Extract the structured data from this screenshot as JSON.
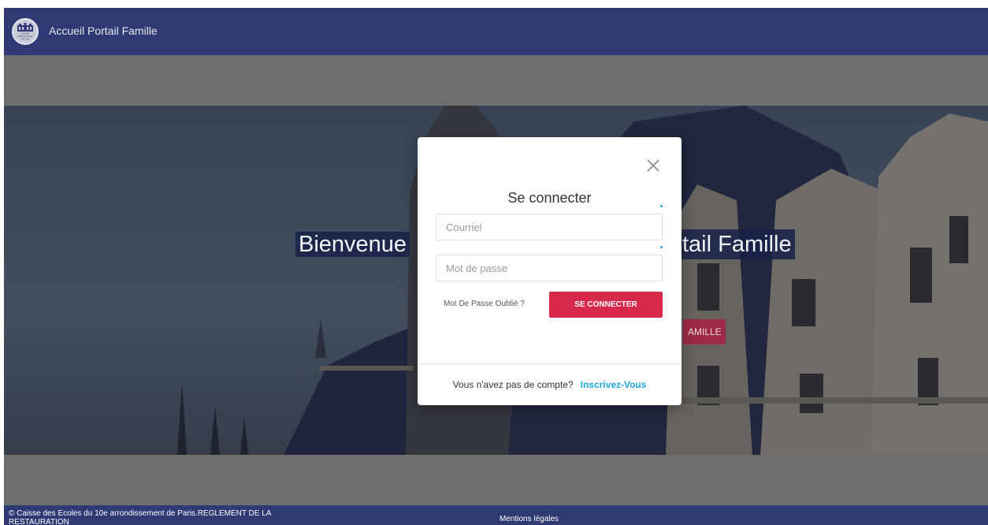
{
  "header": {
    "title": "Accueil Portail Famille",
    "logo_lines": [
      "CAISSE",
      "DES ÉCOLES",
      "DU 10E"
    ]
  },
  "hero": {
    "title_left": "Bienvenue",
    "title_right": "tail Famille",
    "button_label": "AMILLE"
  },
  "modal": {
    "title": "Se connecter",
    "email_placeholder": "Courriel",
    "password_placeholder": "Mot de passe",
    "forgot_label": "Mot De Passe Oublié ?",
    "login_label": "SE CONNECTER",
    "signup_prompt": "Vous n'avez pas de compte?",
    "signup_link": "Inscrivez-Vous"
  },
  "footer": {
    "copyright": "© Caisse des Ecoles du 10e arrondissement de Paris.REGLEMENT DE LA RESTAURATION",
    "legal_link": "Mentions légales"
  },
  "colors": {
    "header_bg": "#2f3a75",
    "primary_button": "#d72a4a",
    "link": "#1fa8e0",
    "overlay_band": "#6f6f6f"
  }
}
